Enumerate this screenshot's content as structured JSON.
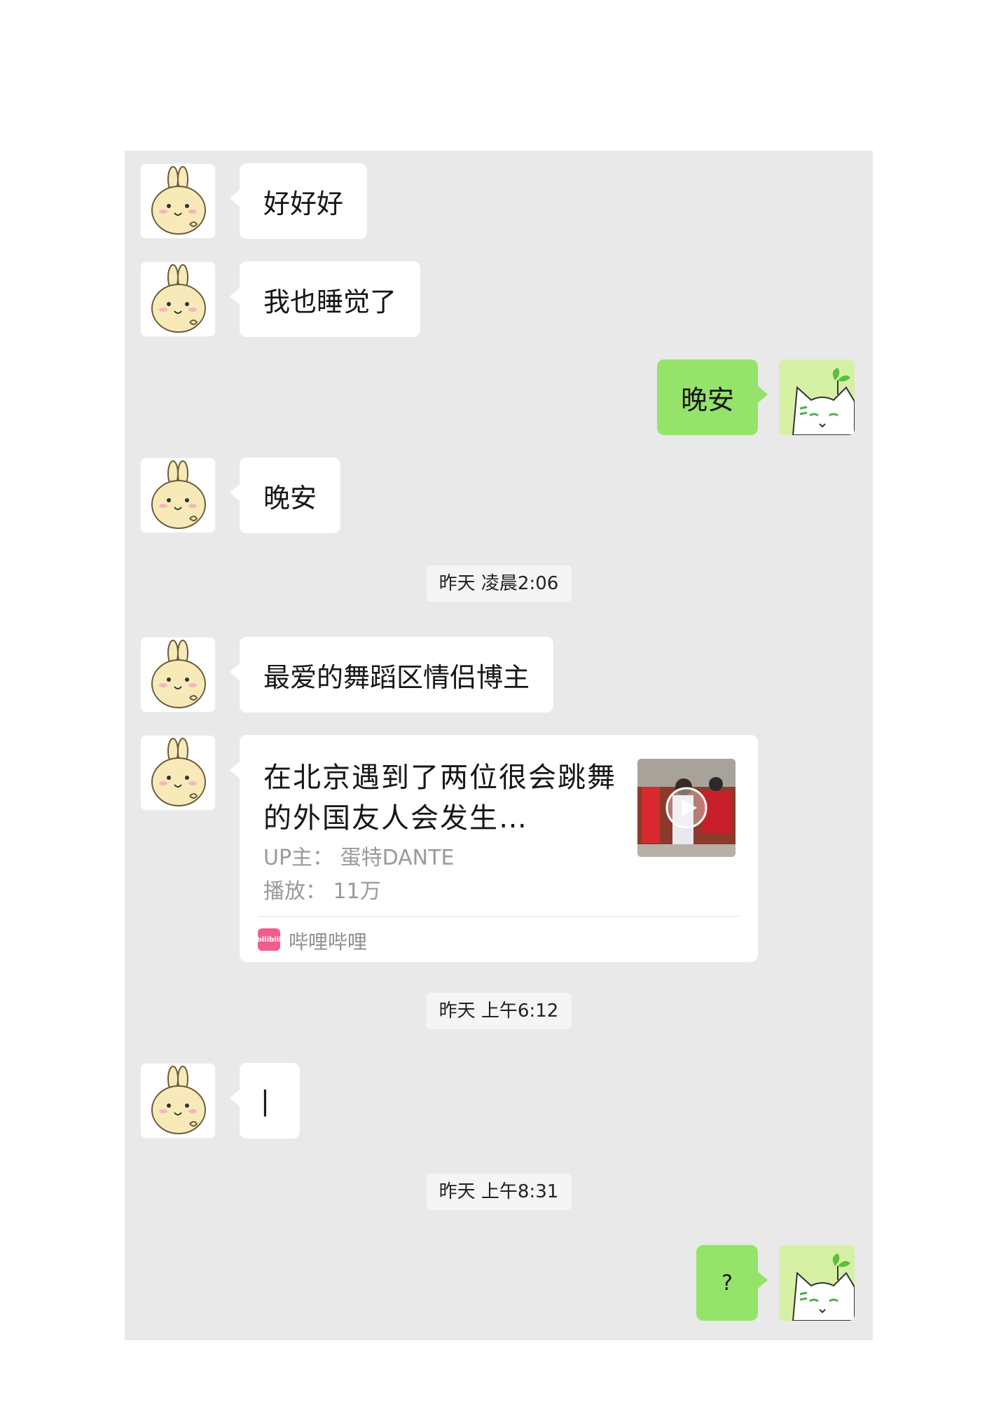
{
  "theme": {
    "incoming_bubble": "#ffffff",
    "outgoing_bubble": "#95e36b",
    "chat_background": "#e9e9e9",
    "bilibili_pink": "#f15d8f"
  },
  "avatars": {
    "contact": "rabbit-avatar",
    "self": "cat-avatar"
  },
  "messages": [
    {
      "text": "好好好"
    },
    {
      "text": "我也睡觉了"
    },
    {
      "text": "晚安"
    },
    {
      "text": "晚安"
    },
    {
      "time": "昨天 凌晨2:06"
    },
    {
      "text": "最爱的舞蹈区情侣博主"
    },
    {
      "card": {
        "title": "在北京遇到了两位很会跳舞的外国友人会发生…",
        "uploader": "UP主：  蛋特DANTE",
        "plays": "播放：  11万",
        "source": "哔哩哔哩",
        "logo_text": "bilibili"
      }
    },
    {
      "time": "昨天 上午6:12"
    },
    {
      "text": "|"
    },
    {
      "time": "昨天 上午8:31"
    },
    {
      "text": "?"
    }
  ]
}
